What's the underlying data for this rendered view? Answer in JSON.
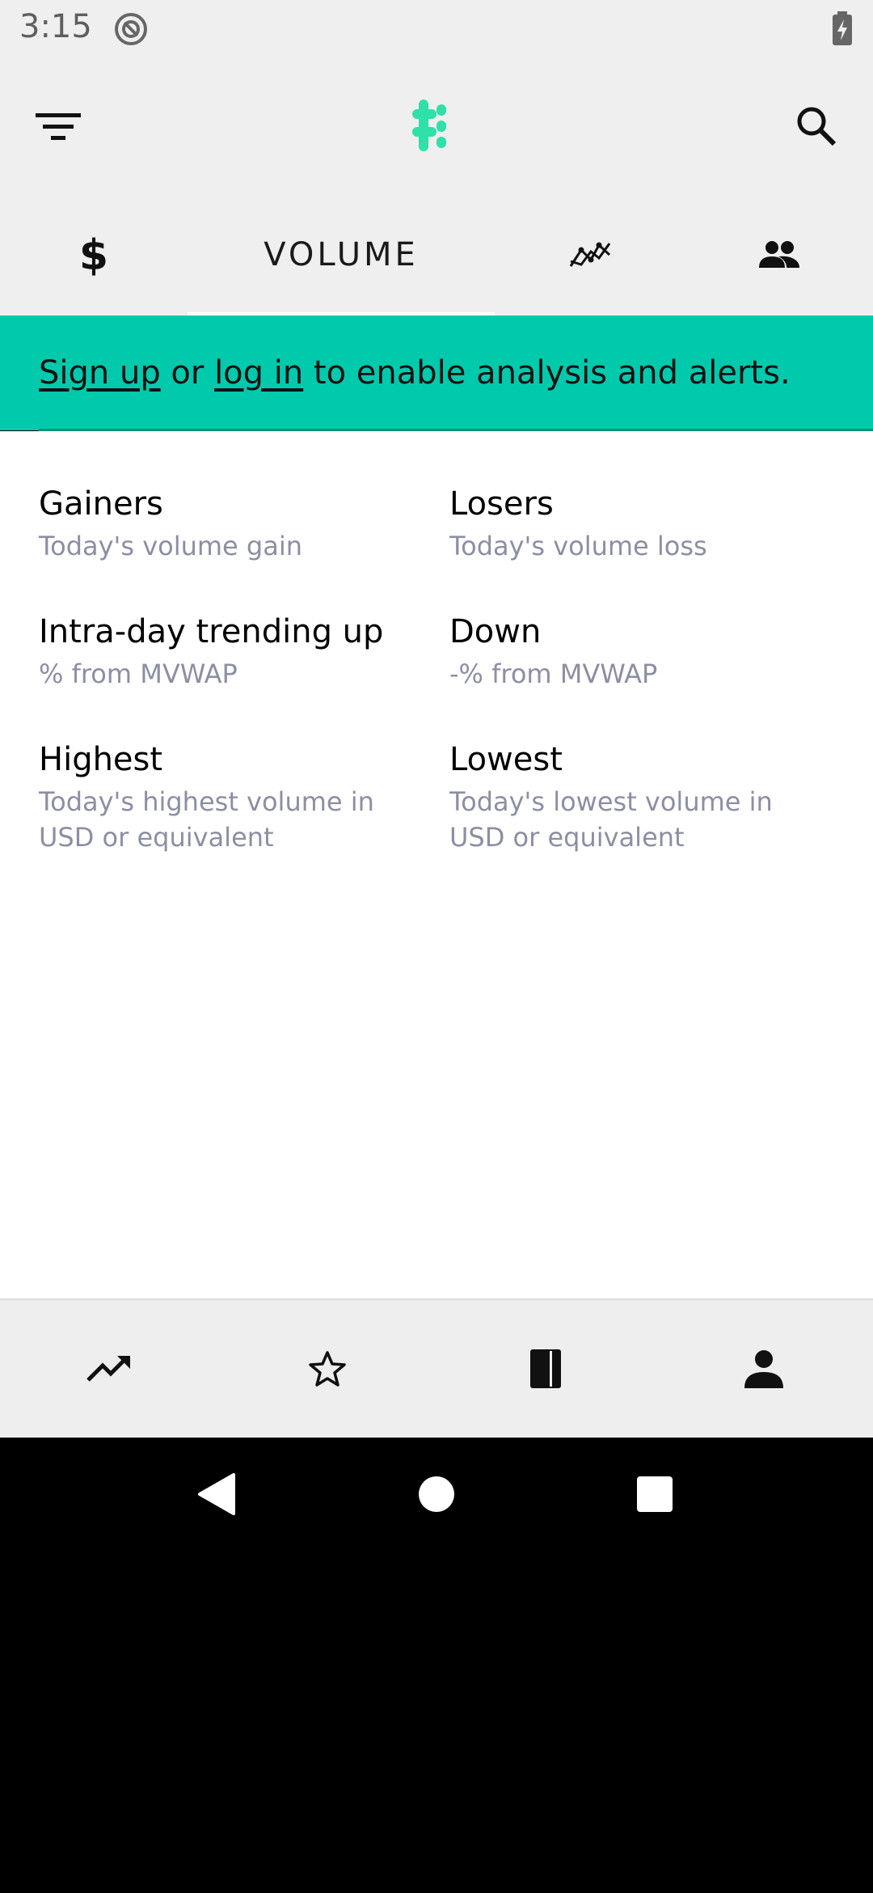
{
  "status_bar": {
    "time": "3:15"
  },
  "app_bar": {
    "filter_icon": "filter-icon",
    "logo_icon": "app-logo-icon",
    "search_icon": "search-icon",
    "accent_color": "#2fe0a9"
  },
  "tabs": {
    "items": [
      {
        "icon": "dollar-icon",
        "label": ""
      },
      {
        "icon": "",
        "label": "VOLUME",
        "selected": true
      },
      {
        "icon": "line-chart-icon",
        "label": ""
      },
      {
        "icon": "people-icon",
        "label": ""
      }
    ]
  },
  "banner": {
    "sign_up": "Sign up",
    "or": " or ",
    "log_in": "log in",
    "rest": " to enable analysis and alerts.",
    "background": "#00c9ac"
  },
  "items": [
    {
      "title": "Gainers",
      "subtitle": "Today's volume gain"
    },
    {
      "title": "Losers",
      "subtitle": "Today's volume loss"
    },
    {
      "title": "Intra-day trending up",
      "subtitle": "% from MVWAP"
    },
    {
      "title": "Down",
      "subtitle": "-% from MVWAP"
    },
    {
      "title": "Highest",
      "subtitle": "Today's highest volume in USD or equivalent"
    },
    {
      "title": "Lowest",
      "subtitle": "Today's lowest volume in USD or equivalent"
    }
  ],
  "bottom_nav": {
    "items": [
      {
        "icon": "trending-up-icon"
      },
      {
        "icon": "star-icon"
      },
      {
        "icon": "book-icon"
      },
      {
        "icon": "person-icon"
      }
    ]
  }
}
